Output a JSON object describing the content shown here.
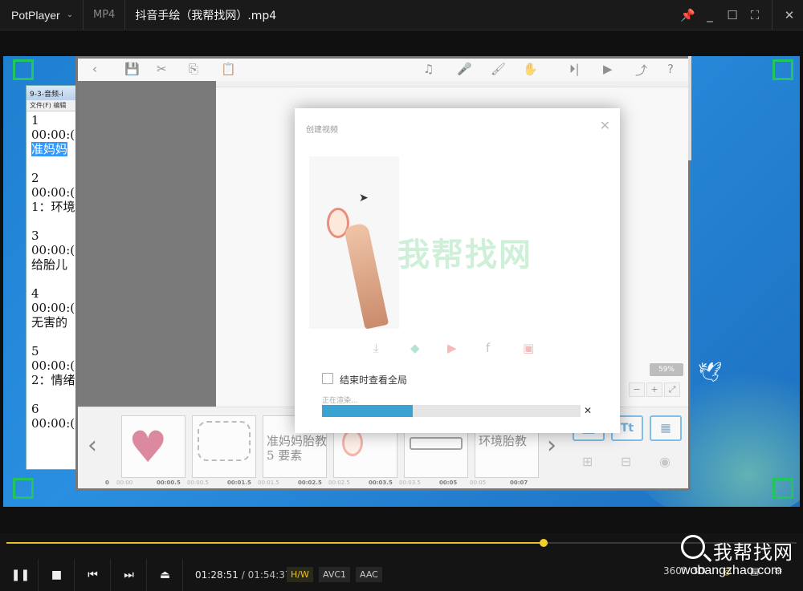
{
  "titlebar": {
    "app_name": "PotPlayer",
    "format": "MP4",
    "file_title": "抖音手绘（我帮找网）.mp4"
  },
  "notepad": {
    "title": "9-3-音频-i",
    "menu": "文件(F)  编辑",
    "lines": [
      "1",
      "00:00:(",
      "准妈妈",
      "",
      "2",
      "00:00:(",
      "1：环境",
      "",
      "3",
      "00:00:(",
      "给胎儿",
      "",
      "4",
      "00:00:(",
      "无害的",
      "",
      "5",
      "00:00:(",
      "2：情绪",
      "",
      "6",
      "00:00:("
    ],
    "highlight_line": 2
  },
  "editor": {
    "zoom": "59%",
    "thumbnails": [
      {
        "label": ""
      },
      {
        "label": ""
      },
      {
        "label": "准妈妈胎教\n5 要素"
      },
      {
        "label": ""
      },
      {
        "label": ""
      },
      {
        "label": "环境胎教"
      }
    ],
    "times": [
      "0",
      "00:00",
      "00:00.5",
      "00:00.5",
      "00:01.5",
      "00:01.5",
      "00:02.5",
      "00:02.5",
      "00:03.5",
      "00:03.5",
      "00:05",
      "00:05",
      "00:07"
    ],
    "side_buttons": [
      "",
      "Tt",
      ""
    ]
  },
  "dialog": {
    "title": "创建视频",
    "watermark": "我帮找网",
    "checkbox_label": "结束时查看全局",
    "status": "正在渲染...",
    "progress": 0.35
  },
  "player": {
    "seek_progress": 0.68,
    "current_time": "01:28:51",
    "separator": "/",
    "total_time": "01:54:37",
    "tags": [
      "H/W",
      "AVC1",
      "AAC"
    ],
    "right_labels": [
      "360°",
      "3D"
    ],
    "watermark_big": "我帮找网",
    "watermark_small": "wobangzhao.com"
  }
}
